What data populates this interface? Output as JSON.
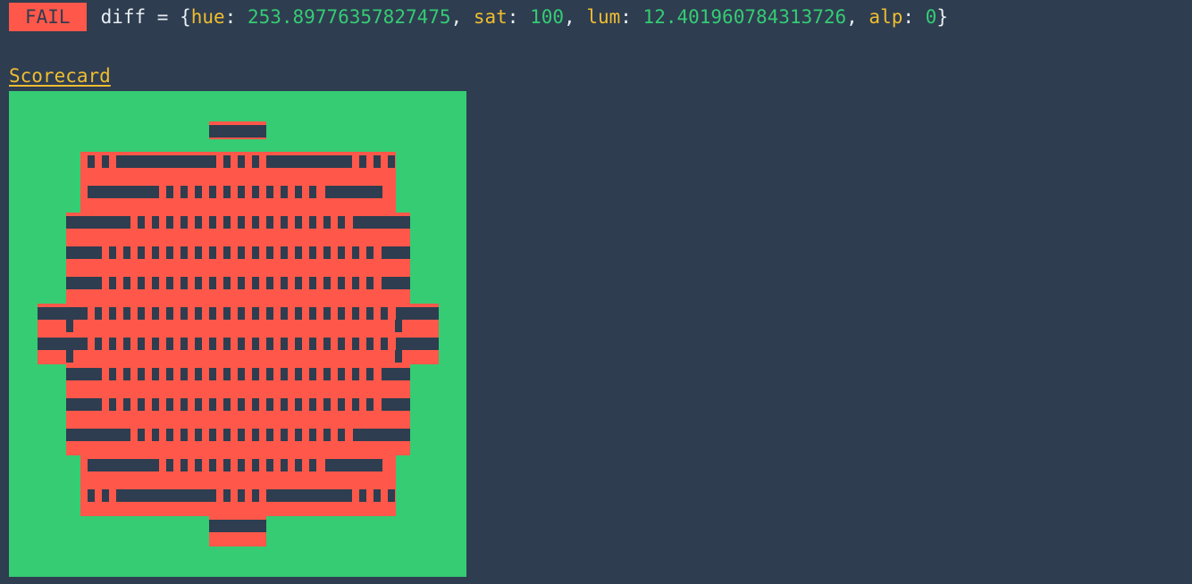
{
  "status": {
    "badge": "FAIL",
    "prefix": "diff = {",
    "entries": [
      {
        "key": "hue",
        "sep": ": ",
        "value": "253.89776357827475",
        "trail": ", "
      },
      {
        "key": "sat",
        "sep": ": ",
        "value": "100",
        "trail": ", "
      },
      {
        "key": "lum",
        "sep": ": ",
        "value": "12.401960784313726",
        "trail": ", "
      },
      {
        "key": "alp",
        "sep": ": ",
        "value": "0",
        "trail": ""
      }
    ],
    "suffix": "}"
  },
  "scorecard": {
    "link_text": "Scorecard"
  },
  "colors": {
    "background": "#2e3d50",
    "badge": "#ff584a",
    "panel": "#35cc74",
    "shape": "#ff584a",
    "key": "#f0bd30",
    "number": "#35cc74",
    "text": "#e8eef2"
  }
}
